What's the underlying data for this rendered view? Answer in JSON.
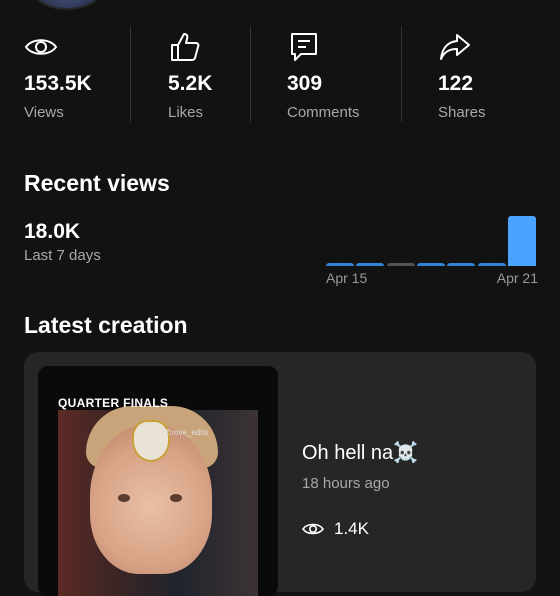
{
  "stats": [
    {
      "value": "153.5K",
      "label": "Views",
      "icon": "eye-icon"
    },
    {
      "value": "5.2K",
      "label": "Likes",
      "icon": "thumbs-up-icon"
    },
    {
      "value": "309",
      "label": "Comments",
      "icon": "comment-icon"
    },
    {
      "value": "122",
      "label": "Shares",
      "icon": "share-icon"
    }
  ],
  "recent_views": {
    "heading": "Recent views",
    "value": "18.0K",
    "period": "Last 7 days"
  },
  "chart_data": {
    "type": "bar",
    "categories": [
      "Apr 15",
      "Apr 16",
      "Apr 17",
      "Apr 18",
      "Apr 19",
      "Apr 20",
      "Apr 21"
    ],
    "values": [
      0.6,
      0.6,
      0.4,
      0.6,
      0.6,
      0.8,
      18.0
    ],
    "tick_labels": [
      "Apr 15",
      "Apr 21"
    ],
    "ylim": [
      0,
      18.0
    ],
    "colors": [
      "#2e86d4",
      "#2e86d4",
      "#555555",
      "#2e86d4",
      "#2e86d4",
      "#2e86d4",
      "#4aa3ff"
    ]
  },
  "latest": {
    "heading": "Latest creation",
    "title": "Oh hell na",
    "emoji": "☠️",
    "time": "18 hours ago",
    "views": "1.4K",
    "thumb_caption": "QUARTER FINALS",
    "thumb_watermark": "Erove_edits"
  }
}
